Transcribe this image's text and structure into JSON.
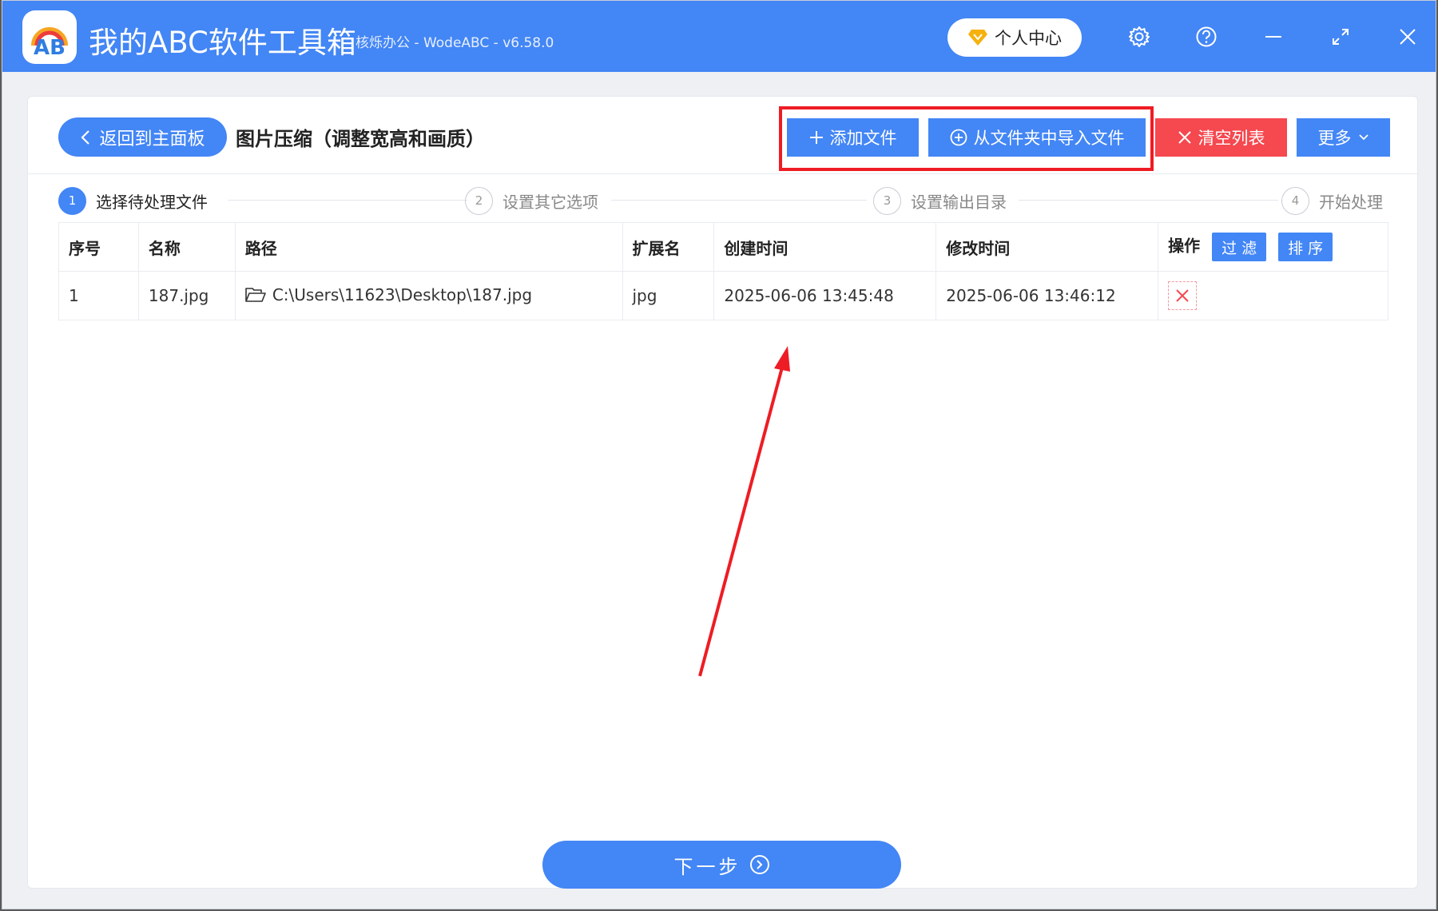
{
  "app": {
    "title": "我的ABC软件工具箱",
    "subtitle": "核烁办公 - WodeABC - v6.58.0",
    "logo_text": "AB",
    "user_center_label": "个人中心"
  },
  "window_controls": [
    "gear-icon",
    "help-icon",
    "minimize-icon",
    "maximize-icon",
    "close-icon"
  ],
  "toolbar": {
    "back_label": "返回到主面板",
    "page_title": "图片压缩（调整宽高和画质）",
    "add_file_label": "添加文件",
    "import_folder_label": "从文件夹中导入文件",
    "clear_list_label": "清空列表",
    "more_label": "更多"
  },
  "steps": [
    {
      "num": "1",
      "label": "选择待处理文件",
      "active": true
    },
    {
      "num": "2",
      "label": "设置其它选项",
      "active": false
    },
    {
      "num": "3",
      "label": "设置输出目录",
      "active": false
    },
    {
      "num": "4",
      "label": "开始处理",
      "active": false
    }
  ],
  "table": {
    "headers": {
      "index": "序号",
      "name": "名称",
      "path": "路径",
      "ext": "扩展名",
      "created": "创建时间",
      "modified": "修改时间",
      "actions": "操作"
    },
    "filter_label": "过 滤",
    "sort_label": "排 序",
    "rows": [
      {
        "index": "1",
        "name": "187.jpg",
        "path": "C:\\Users\\11623\\Desktop\\187.jpg",
        "ext": "jpg",
        "created": "2025-06-06 13:45:48",
        "modified": "2025-06-06 13:46:12"
      }
    ]
  },
  "next_label": "下一步",
  "colors": {
    "primary": "#4386f5",
    "danger": "#f5484f",
    "highlight": "#ee1c24"
  }
}
